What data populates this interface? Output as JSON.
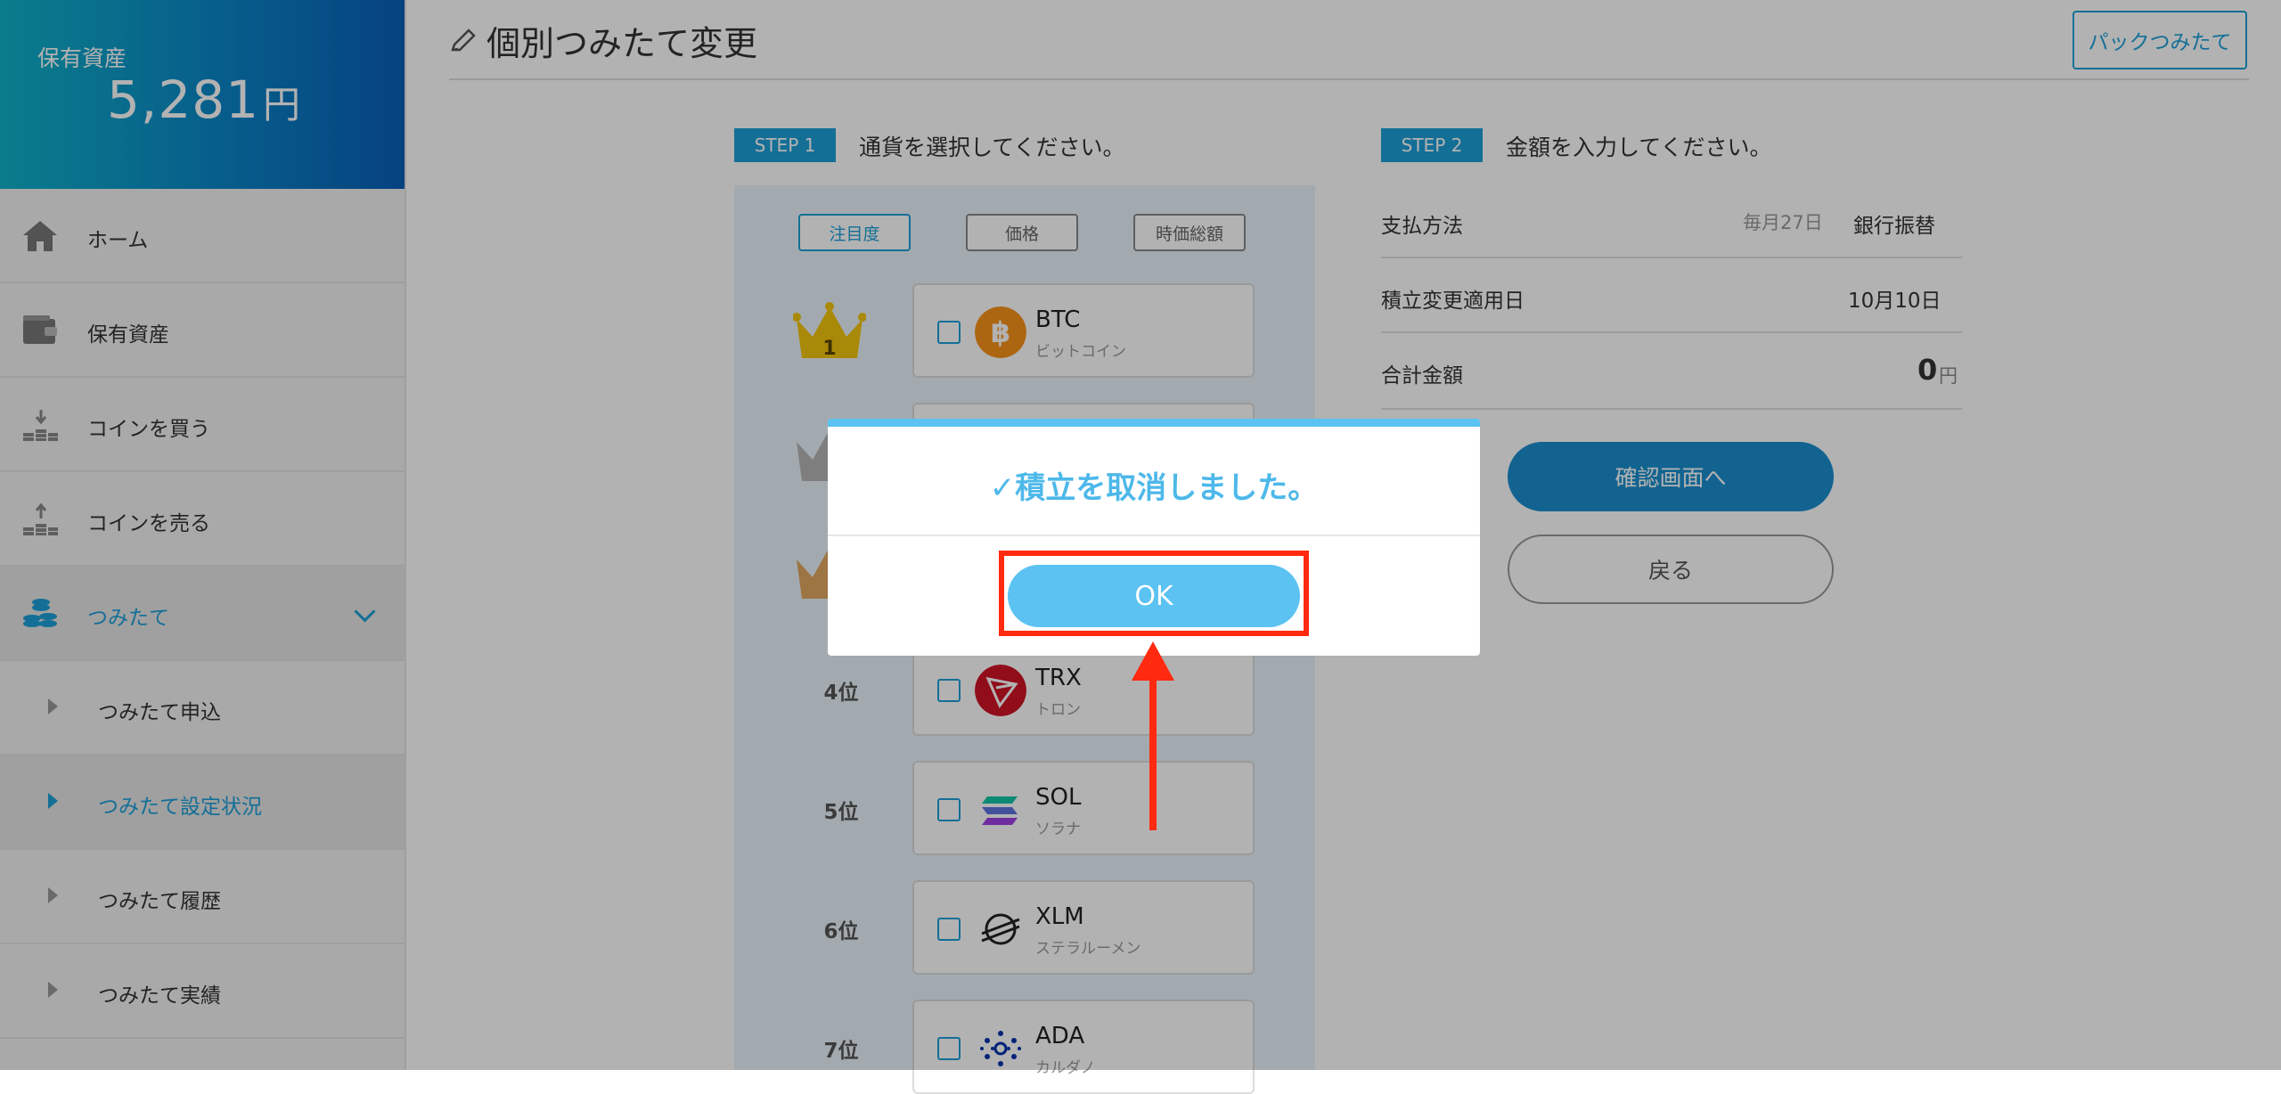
{
  "sidebar": {
    "asset_label": "保有資産",
    "asset_value": "5,281",
    "asset_unit": "円",
    "items": [
      {
        "label": "ホーム",
        "icon": "home-icon"
      },
      {
        "label": "保有資産",
        "icon": "wallet-icon"
      },
      {
        "label": "コインを買う",
        "icon": "buy-coins-icon"
      },
      {
        "label": "コインを売る",
        "icon": "sell-coins-icon"
      },
      {
        "label": "つみたて",
        "icon": "coins-stack-icon"
      }
    ],
    "sub_items": [
      {
        "label": "つみたて申込"
      },
      {
        "label": "つみたて設定状況"
      },
      {
        "label": "つみたて履歴"
      },
      {
        "label": "つみたて実績"
      }
    ]
  },
  "header": {
    "title": "個別つみたて変更",
    "pack_button": "パックつみたて"
  },
  "step1": {
    "badge": "STEP 1",
    "text": "通貨を選択してください。",
    "sort_buttons": [
      "注目度",
      "価格",
      "時価総額"
    ],
    "coins": [
      {
        "rank": "1",
        "symbol": "BTC",
        "name": "ビットコイン",
        "color": "#f7931a"
      },
      {
        "rank": "4位",
        "symbol": "TRX",
        "name": "トロン",
        "color": "#d01426"
      },
      {
        "rank": "5位",
        "symbol": "SOL",
        "name": "ソラナ",
        "color": "#7b3fe4"
      },
      {
        "rank": "6位",
        "symbol": "XLM",
        "name": "ステラルーメン",
        "color": "#222222"
      },
      {
        "rank": "7位",
        "symbol": "ADA",
        "name": "カルダノ",
        "color": "#0033ad"
      }
    ]
  },
  "step2": {
    "badge": "STEP 2",
    "text": "金額を入力してください。",
    "payment_label": "支払方法",
    "payment_date": "毎月27日",
    "payment_method": "銀行振替",
    "apply_date_label": "積立変更適用日",
    "apply_date": "10月10日",
    "total_label": "合計金額",
    "total_value": "0",
    "total_unit": "円",
    "confirm_button": "確認画面へ",
    "back_button": "戻る"
  },
  "modal": {
    "message": "✓積立を取消しました。",
    "ok_button": "OK"
  },
  "colors": {
    "accent": "#1da0d8",
    "modal_accent": "#5bc2f2",
    "highlight": "#ff2a10"
  }
}
